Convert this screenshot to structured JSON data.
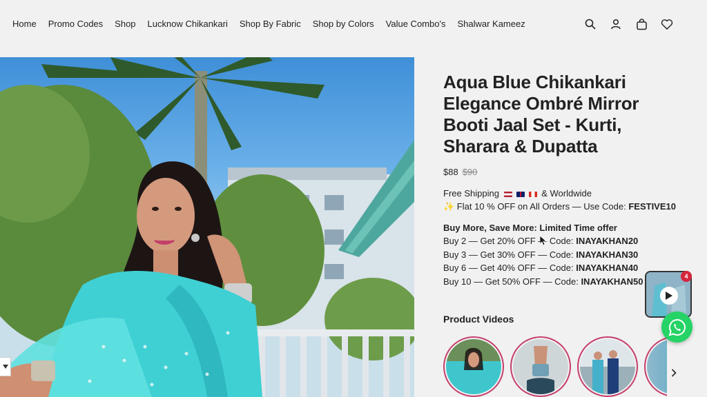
{
  "nav": {
    "items": [
      {
        "label": "Home"
      },
      {
        "label": "Promo Codes"
      },
      {
        "label": "Shop"
      },
      {
        "label": "Lucknow Chikankari"
      },
      {
        "label": "Shop By Fabric"
      },
      {
        "label": "Shop by Colors"
      },
      {
        "label": "Value Combo's"
      },
      {
        "label": "Shalwar Kameez"
      }
    ]
  },
  "header_icons": [
    "search-icon",
    "account-icon",
    "cart-icon",
    "wishlist-icon"
  ],
  "product": {
    "title": "Aqua Blue Chikankari Elegance Ombré Mirror Booti Jaal Set - Kurti, Sharara & Dupatta",
    "price": "$88",
    "compare_price": "$90",
    "shipping_prefix": "Free Shipping",
    "shipping_suffix": "& Worldwide",
    "flat_offer_text": "✨ Flat 10 % OFF on All Orders — Use Code:",
    "flat_offer_code": "FESTIVE10",
    "offer_heading": "Buy More, Save More: Limited Time offer",
    "offers": [
      {
        "text": "Buy 2 — Get 20% OFF — Code:",
        "code": "INAYAKHAN20"
      },
      {
        "text": "Buy 3 — Get 30% OFF — Code:",
        "code": "INAYAKHAN30"
      },
      {
        "text": "Buy 6 — Get 40% OFF — Code:",
        "code": "INAYAKHAN40"
      },
      {
        "text": "Buy 10 — Get 50% OFF — Code:",
        "code": "INAYAKHAN50"
      }
    ],
    "videos_heading": "Product Videos"
  },
  "widget": {
    "badge_count": "4"
  },
  "colors": {
    "background": "#f1f1f1",
    "text": "#222222",
    "thumb_ring": "#c53d6b",
    "whatsapp": "#25d366",
    "badge": "#d7263d",
    "dupatta": "#3fd0d4"
  }
}
